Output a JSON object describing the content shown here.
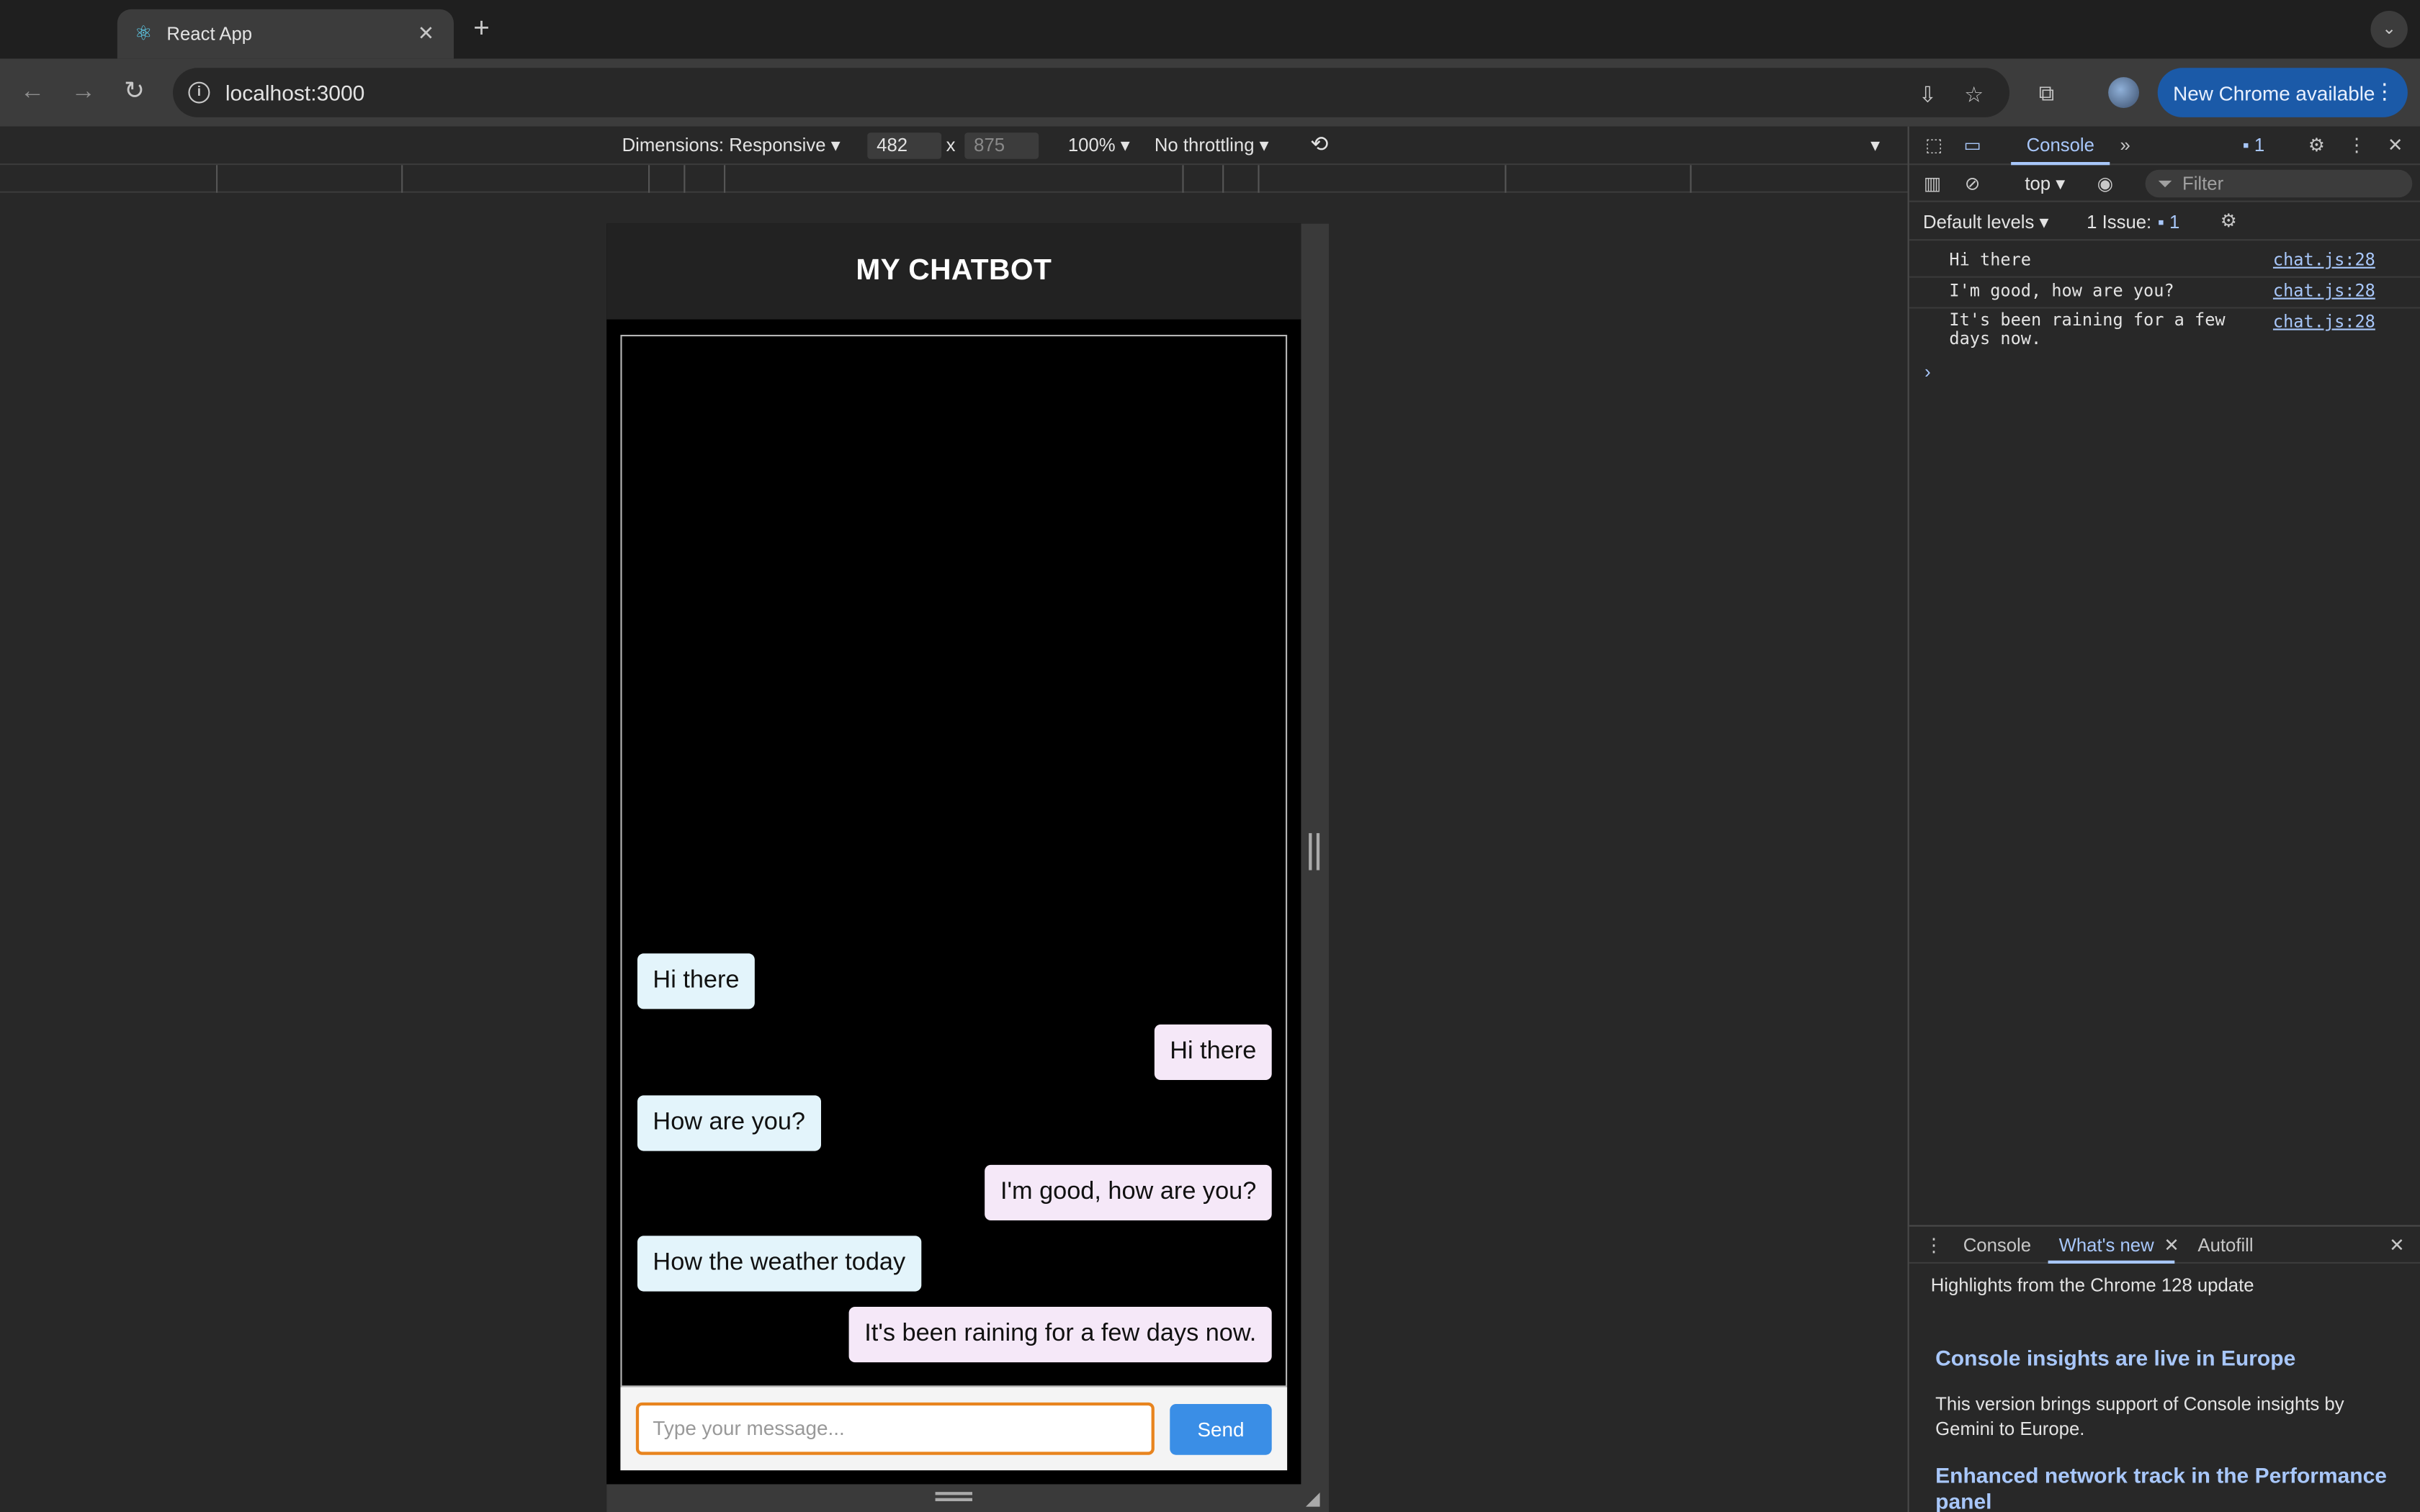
{
  "browser": {
    "tab_title": "React App",
    "url": "localhost:3000",
    "update_button": "New Chrome available"
  },
  "device_toolbar": {
    "dimensions_label": "Dimensions: Responsive",
    "width": "482",
    "height": "875",
    "times": "x",
    "zoom": "100%",
    "throttling": "No throttling"
  },
  "chat": {
    "title": "MY CHATBOT",
    "messages": [
      {
        "side": "left",
        "text": "Hi there"
      },
      {
        "side": "right",
        "text": "Hi there"
      },
      {
        "side": "left",
        "text": "How are you?"
      },
      {
        "side": "right",
        "text": "I'm good, how are you?"
      },
      {
        "side": "left",
        "text": "How the weather today"
      },
      {
        "side": "right",
        "text": "It's been raining for a few days now."
      }
    ],
    "input_placeholder": "Type your message...",
    "send_label": "Send"
  },
  "devtools": {
    "active_tab": "Console",
    "issues_badge": "1",
    "context": "top",
    "filter_placeholder": "Filter",
    "levels": "Default levels",
    "issues_label": "1 Issue:",
    "issues_count": "1",
    "logs": [
      {
        "text": "Hi there",
        "source": "chat.js:28"
      },
      {
        "text": "I'm good, how are you?",
        "source": "chat.js:28"
      },
      {
        "text": "It's been raining for a few days now.",
        "source": "chat.js:28"
      }
    ],
    "drawer": {
      "tabs": [
        "Console",
        "What's new",
        "Autofill"
      ],
      "highlights": "Highlights from the Chrome 128 update",
      "items": [
        {
          "heading": "Console insights are live in Europe",
          "body": "This version brings support of Console insights by Gemini to Europe."
        },
        {
          "heading": "Enhanced network track in the Performance panel",
          "body": ""
        }
      ]
    }
  },
  "colors": {
    "left_bubble": "#e3f4fb",
    "right_bubble": "#f5e8f8",
    "send_button": "#3a8ee6",
    "input_focus": "#e8841e",
    "devtools_accent": "#a8c7fa"
  }
}
